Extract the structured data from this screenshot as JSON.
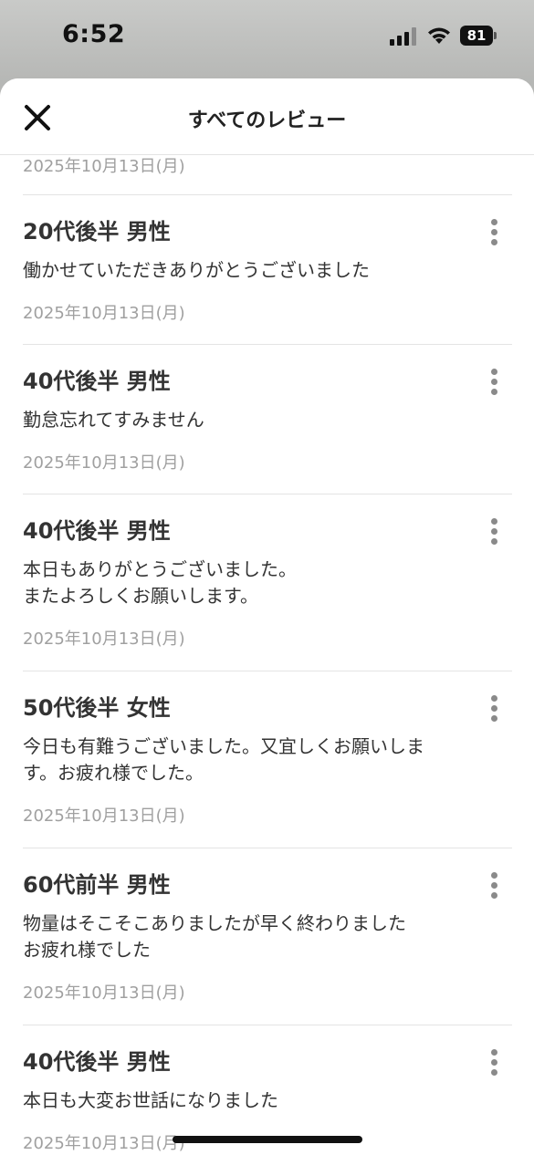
{
  "status_bar": {
    "time": "6:52",
    "battery": "81",
    "icons": [
      "signal-icon",
      "wifi-icon",
      "battery-icon"
    ]
  },
  "header": {
    "title": "すべてのレビュー",
    "close_icon": "close-icon"
  },
  "top_partial_date": "2025年10月13日(月)",
  "reviews": [
    {
      "reviewer": "20代後半 男性",
      "lines": [
        "働かせていただきありがとうございました"
      ],
      "date": "2025年10月13日(月)"
    },
    {
      "reviewer": "40代後半 男性",
      "lines": [
        "勤怠忘れてすみません"
      ],
      "date": "2025年10月13日(月)"
    },
    {
      "reviewer": "40代後半 男性",
      "lines": [
        "本日もありがとうございました。",
        "またよろしくお願いします。"
      ],
      "date": "2025年10月13日(月)"
    },
    {
      "reviewer": "50代後半 女性",
      "lines": [
        "今日も有難うございました。又宜しくお願いしま",
        "す。お疲れ様でした。"
      ],
      "date": "2025年10月13日(月)"
    },
    {
      "reviewer": "60代前半 男性",
      "lines": [
        "物量はそこそこありましたが早く終わりました",
        "お疲れ様でした"
      ],
      "date": "2025年10月13日(月)"
    },
    {
      "reviewer": "40代後半 男性",
      "lines": [
        "本日も大変お世話になりました"
      ],
      "date": "2025年10月13日(月)"
    }
  ],
  "more_icon": "more-vertical-icon"
}
